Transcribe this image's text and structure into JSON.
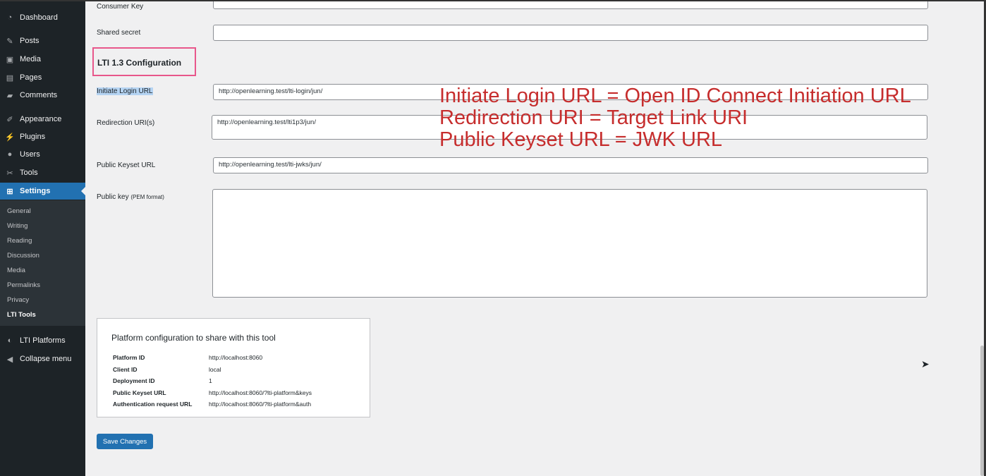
{
  "menu": [
    {
      "label": "Dashboard",
      "icon": "dashboard-icon",
      "glyph": "◔"
    },
    {
      "label": "Posts",
      "icon": "pin-icon",
      "glyph": "✎"
    },
    {
      "label": "Media",
      "icon": "media-icon",
      "glyph": "▣"
    },
    {
      "label": "Pages",
      "icon": "pages-icon",
      "glyph": "▤"
    },
    {
      "label": "Comments",
      "icon": "comments-icon",
      "glyph": "▰"
    },
    {
      "label": "Appearance",
      "icon": "appearance-icon",
      "glyph": "✐"
    },
    {
      "label": "Plugins",
      "icon": "plugins-icon",
      "glyph": "⚡"
    },
    {
      "label": "Users",
      "icon": "users-icon",
      "glyph": "●"
    },
    {
      "label": "Tools",
      "icon": "tools-icon",
      "glyph": "✂"
    },
    {
      "label": "Settings",
      "icon": "settings-icon",
      "glyph": "⊞"
    },
    {
      "label": "LTI Platforms",
      "icon": "lti-platforms-icon",
      "glyph": "◐"
    },
    {
      "label": "Collapse menu",
      "icon": "collapse-icon",
      "glyph": "◀"
    }
  ],
  "submenu": [
    "General",
    "Writing",
    "Reading",
    "Discussion",
    "Media",
    "Permalinks",
    "Privacy",
    "LTI Tools"
  ],
  "form": {
    "consumer_key_label": "Consumer Key",
    "shared_secret_label": "Shared secret",
    "section_title": "LTI 1.3 Configuration",
    "login_label": "Initiate Login URL",
    "login_value": "http://openlearning.test/lti-login/jun/",
    "redirect_label": "Redirection URI(s)",
    "redirect_value": "http://openlearning.test/lti1p3/jun/",
    "keyset_label": "Public Keyset URL",
    "keyset_value": "http://openlearning.test/lti-jwks/jun/",
    "pubkey_label": "Public key",
    "pubkey_hint": "(PEM format)"
  },
  "annotation": [
    "Initiate Login URL = Open ID Connect Initiation URL",
    "Redirection URI = Target Link URI",
    "Public Keyset URL = JWK URL"
  ],
  "platform": {
    "title": "Platform configuration to share with this tool",
    "rows": [
      {
        "k": "Platform ID",
        "v": "http://localhost:8060"
      },
      {
        "k": "Client ID",
        "v": "local"
      },
      {
        "k": "Deployment ID",
        "v": "1"
      },
      {
        "k": "Public Keyset URL",
        "v": "http://localhost:8060/?lti-platform&keys"
      },
      {
        "k": "Authentication request URL",
        "v": "http://localhost:8060/?lti-platform&auth"
      }
    ]
  },
  "save_label": "Save Changes"
}
